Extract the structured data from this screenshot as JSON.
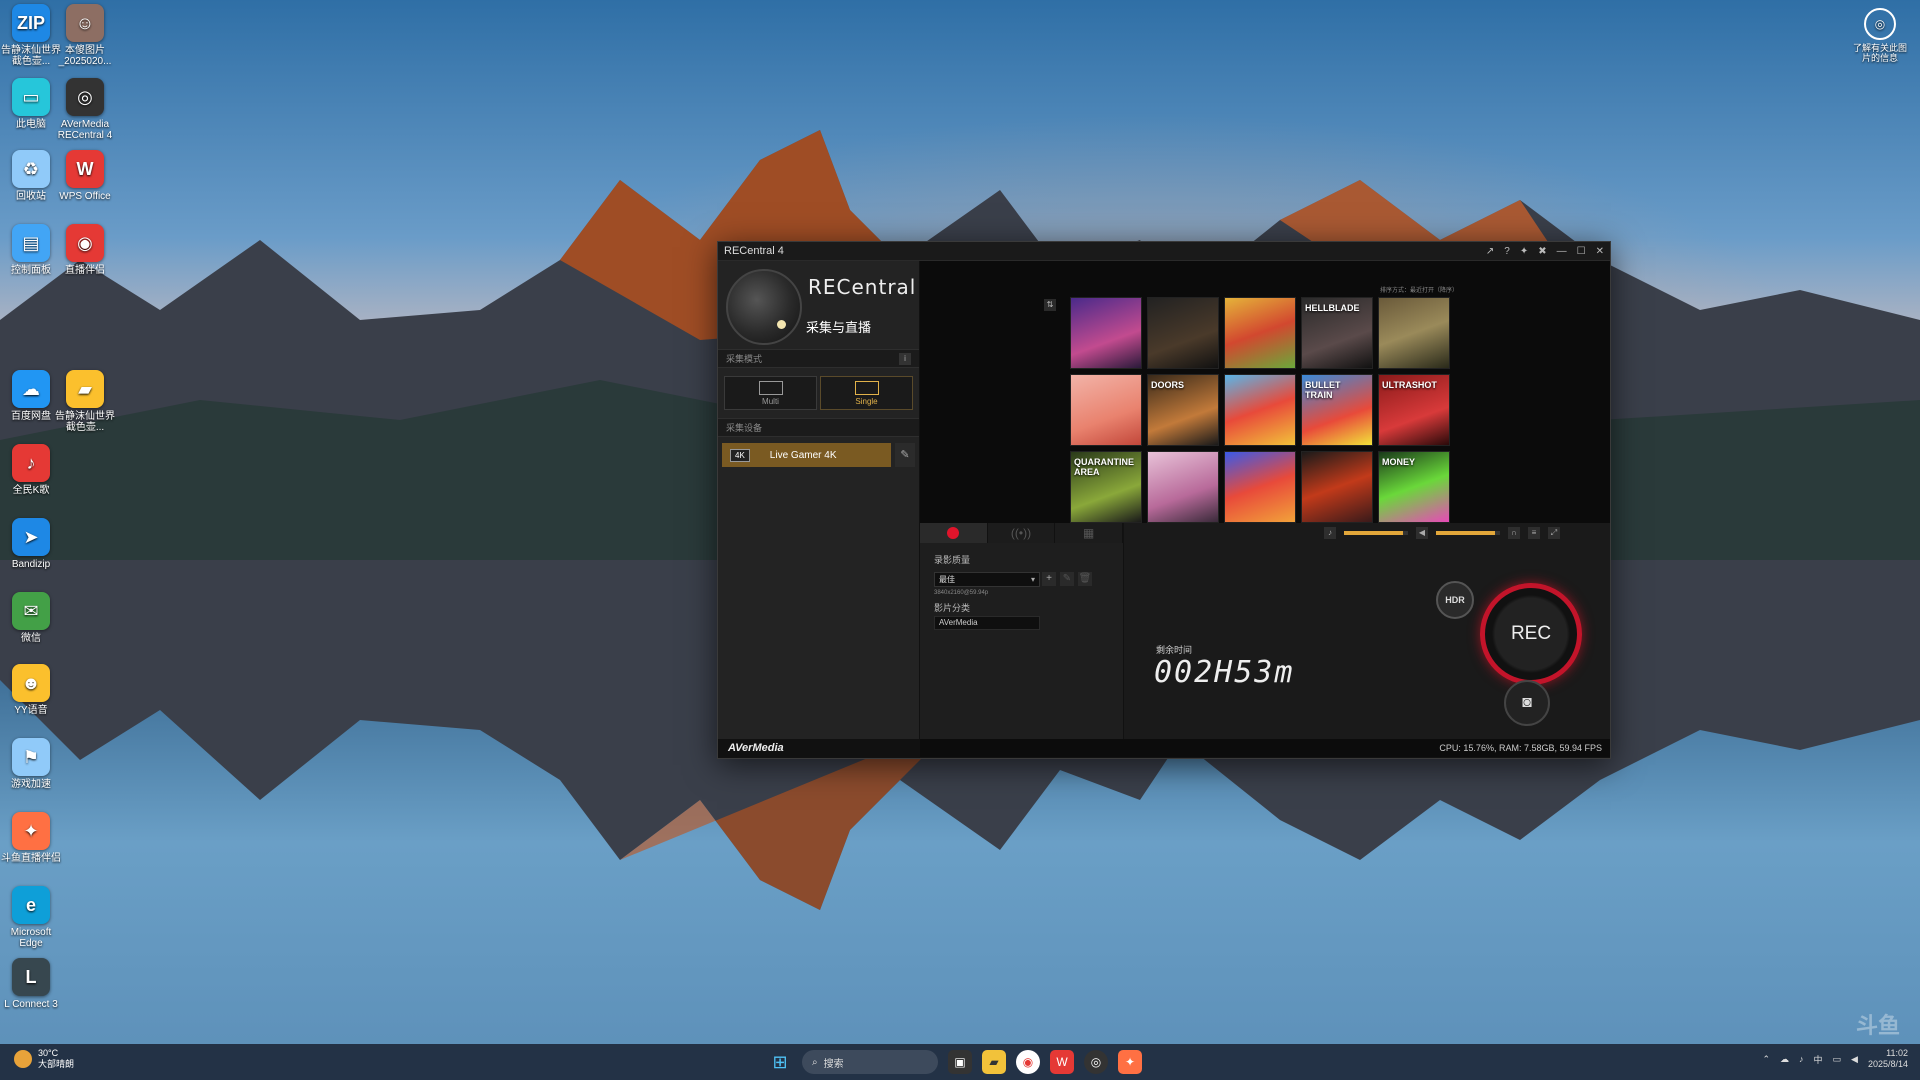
{
  "desktop": {
    "icons": [
      {
        "label": "告静沫仙世界截色壶...",
        "color": "#1e88e5",
        "glyph": "ZIP"
      },
      {
        "label": "本傻图片_2025020...",
        "color": "#8d6e63",
        "glyph": "☺"
      },
      {
        "label": "此电脑",
        "color": "#26c6da",
        "glyph": "▭"
      },
      {
        "label": "AVerMedia RECentral 4",
        "color": "#333333",
        "glyph": "◎"
      },
      {
        "label": "回收站",
        "color": "#90caf9",
        "glyph": "♻"
      },
      {
        "label": "WPS Office",
        "color": "#e53935",
        "glyph": "W"
      },
      {
        "label": "控制面板",
        "color": "#42a5f5",
        "glyph": "▤"
      },
      {
        "label": "直播伴侣",
        "color": "#e53935",
        "glyph": "◉"
      },
      {
        "label": "百度网盘",
        "color": "#2196f3",
        "glyph": "☁"
      },
      {
        "label": "告静沫仙世界截色壶...",
        "color": "#fbc02d",
        "glyph": "▰"
      },
      {
        "label": "全民K歌",
        "color": "#e53935",
        "glyph": "♪"
      },
      {
        "label": "Bandizip",
        "color": "#1e88e5",
        "glyph": "➤"
      },
      {
        "label": "微信",
        "color": "#43a047",
        "glyph": "✉"
      },
      {
        "label": "YY语音",
        "color": "#fbc02d",
        "glyph": "☻"
      },
      {
        "label": "游戏加速",
        "color": "#90caf9",
        "glyph": "⚑"
      },
      {
        "label": "斗鱼直播伴侣",
        "color": "#ff7043",
        "glyph": "✦"
      },
      {
        "label": "Microsoft Edge",
        "color": "#0e9fd8",
        "glyph": "e"
      },
      {
        "label": "L Connect 3",
        "color": "#37474f",
        "glyph": "L"
      }
    ],
    "top_right_label": "了解有关此图片的信息",
    "watermark": "斗鱼"
  },
  "window": {
    "title": "RECentral 4",
    "controls": [
      "↗",
      "?",
      "✦",
      "✖",
      "—",
      "☐",
      "✕"
    ],
    "brand": "RECentral",
    "brand_sub": "采集与直播",
    "capture_mode_label": "采集模式",
    "modes": [
      {
        "label": "Multi",
        "active": false
      },
      {
        "label": "Single",
        "active": true
      }
    ],
    "device_label": "采集设备",
    "device_name": "Live Gamer 4K",
    "device_badge": "4K",
    "footer_brand": "AVerMedia",
    "preview_caption": "排序方式：最近打开（降序）",
    "games": [
      {
        "name": "",
        "bg": "linear-gradient(160deg,#4a2a8a,#c24b8f 60%,#2a1a3a)"
      },
      {
        "name": "",
        "bg": "linear-gradient(160deg,#222,#4a3a2a 60%,#111)"
      },
      {
        "name": "",
        "bg": "linear-gradient(160deg,#e5b33a,#d2482f 50%,#6ba83a)"
      },
      {
        "name": "HELLBLADE",
        "bg": "linear-gradient(160deg,#2a2a2a,#5a4a4a 60%,#111)"
      },
      {
        "name": "",
        "bg": "linear-gradient(160deg,#6a5a3a,#9a8a5a 50%,#2a2a1a)"
      },
      {
        "name": "",
        "bg": "linear-gradient(160deg,#f2b3a8,#e9826e 60%,#c2473a)"
      },
      {
        "name": "DOORS",
        "bg": "linear-gradient(160deg,#3a2a1a,#c27a3a 60%,#1a1a1a)"
      },
      {
        "name": "",
        "bg": "linear-gradient(160deg,#5ab5e8,#e84a3a 50%,#f2c23a)"
      },
      {
        "name": "BULLET TRAIN",
        "bg": "linear-gradient(160deg,#3a8ad8,#e84a3a 60%,#f2e23a)"
      },
      {
        "name": "ULTRASHOT",
        "bg": "linear-gradient(160deg,#8a1a1a,#d83a3a 60%,#2a0a0a)"
      },
      {
        "name": "QUARANTINE AREA",
        "bg": "linear-gradient(160deg,#2a3a1a,#8aa83a 60%,#1a1a1a)"
      },
      {
        "name": "",
        "bg": "linear-gradient(160deg,#e8c2d8,#b86a9a 60%,#3a2a3a)"
      },
      {
        "name": "",
        "bg": "linear-gradient(160deg,#3a5ae8,#e84a3a 50%,#f2a23a)"
      },
      {
        "name": "",
        "bg": "linear-gradient(160deg,#1a1a1a,#c23a1a 50%,#3a1a1a)"
      },
      {
        "name": "MONEY",
        "bg": "linear-gradient(160deg,#1a3a1a,#6ad83a 50%,#e84ab8)"
      }
    ],
    "quality_label": "录影质量",
    "quality_value": "最佳",
    "resolution": "3840x2160@59.94p",
    "category_label": "影片分类",
    "category_value": "AVerMedia",
    "remaining_label": "剩余时间",
    "remaining_value": "002H53m",
    "hdr_label": "HDR",
    "rec_label": "REC",
    "status": "CPU: 15.76%, RAM: 7.58GB, 59.94 FPS"
  },
  "taskbar": {
    "weather_temp": "30°C",
    "weather_desc": "大部晴朗",
    "search_placeholder": "搜索",
    "time": "11:02",
    "date": "2025/8/14",
    "ime": "中"
  }
}
